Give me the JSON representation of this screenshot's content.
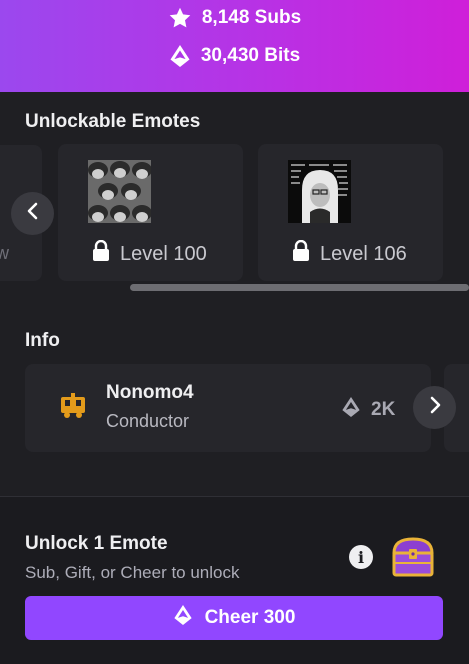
{
  "banner": {
    "subs": "8,148 Subs",
    "bits": "30,430 Bits",
    "subs_icon": "star-icon",
    "bits_icon": "bits-icon",
    "colors": [
      "#9b48ee",
      "#cf1fd9"
    ]
  },
  "emotes": {
    "title": "Unlockable Emotes",
    "ghost_fragment": "w",
    "cards": [
      {
        "level": "Level 100",
        "icon": "lock-icon"
      },
      {
        "level": "Level 106",
        "icon": "lock-icon"
      }
    ]
  },
  "info": {
    "title": "Info",
    "name": "Nonomo4",
    "role": "Conductor",
    "bits": "2K",
    "icon": "train-icon"
  },
  "unlock": {
    "title": "Unlock 1 Emote",
    "subtitle": "Sub, Gift, or Cheer to unlock",
    "button_label": "Cheer 300",
    "accent": "#9147ff"
  }
}
